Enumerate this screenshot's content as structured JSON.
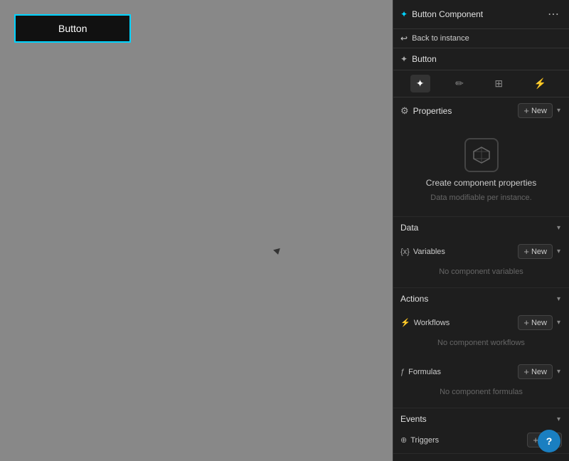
{
  "canvas": {
    "button_label": "Button"
  },
  "panel": {
    "header_title": "Button Component",
    "back_label": "Back to instance",
    "component_name": "Button",
    "tabs": [
      {
        "icon": "✦",
        "label": "layout-tab",
        "active": true
      },
      {
        "icon": "🖊",
        "label": "style-tab",
        "active": false
      },
      {
        "icon": "≡",
        "label": "data-tab",
        "active": false
      },
      {
        "icon": "⚡",
        "label": "actions-tab",
        "active": false
      }
    ],
    "properties_section": {
      "title": "Properties",
      "new_btn": "+ New",
      "create_title": "Create component properties",
      "create_subtitle": "Data modifiable per instance."
    },
    "data_section": {
      "title": "Data",
      "variables_label": "Variables",
      "variables_new": "+ New",
      "variables_empty": "No component variables"
    },
    "actions_section": {
      "title": "Actions",
      "workflows_label": "Workflows",
      "workflows_new": "+ New",
      "workflows_empty": "No component workflows",
      "formulas_label": "Formulas",
      "formulas_new": "+ New",
      "formulas_empty": "No component formulas"
    },
    "events_section": {
      "title": "Events",
      "triggers_label": "Triggers",
      "triggers_new": "+ New"
    }
  }
}
